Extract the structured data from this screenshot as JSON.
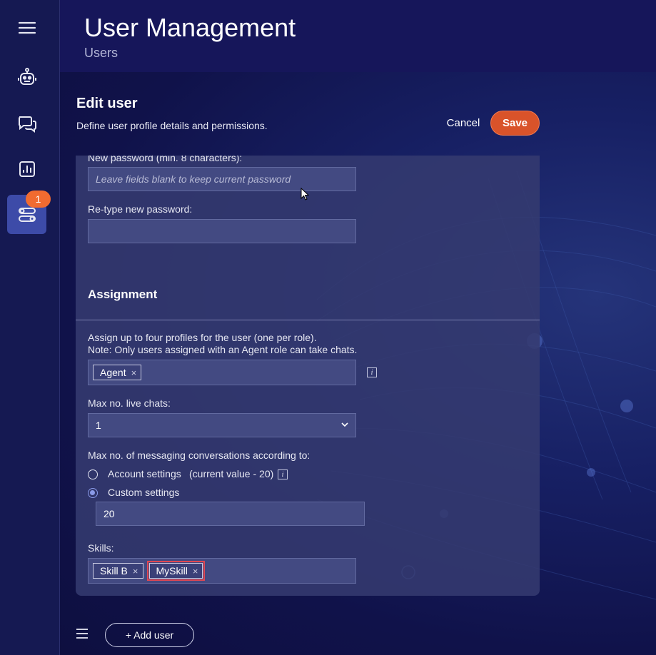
{
  "header": {
    "title": "User Management",
    "subtitle": "Users"
  },
  "sidebar": {
    "items": [
      {
        "icon": "menu-icon"
      },
      {
        "icon": "robot-icon"
      },
      {
        "icon": "chat-bubbles-icon"
      },
      {
        "icon": "chart-icon"
      },
      {
        "icon": "toggles-icon",
        "active": true,
        "badge": "1"
      }
    ]
  },
  "edit": {
    "title": "Edit user",
    "description": "Define user profile details and permissions.",
    "cancel_label": "Cancel",
    "save_label": "Save"
  },
  "form": {
    "new_password_label": "New password (min. 8 characters):",
    "new_password_placeholder": "Leave fields blank to keep current password",
    "retype_label": "Re-type new password:",
    "retype_value": "",
    "assignment_title": "Assignment",
    "profiles_label_line1": "Assign up to four profiles for the user (one per role).",
    "profiles_label_line2": "Note: Only users assigned with an Agent role can take chats.",
    "profiles": [
      "Agent"
    ],
    "max_live_chats_label": "Max no. live chats:",
    "max_live_chats_value": "1",
    "max_messaging_label": "Max no. of messaging conversations according to:",
    "account_settings_label": "Account settings",
    "account_settings_note": "(current value - 20)",
    "custom_settings_label": "Custom settings",
    "custom_value": "20",
    "skills_label": "Skills:",
    "skills": [
      "Skill B",
      "MySkill"
    ],
    "chip_remove": "×",
    "info_glyph": "i"
  },
  "footer": {
    "add_user_label": "+ Add user"
  },
  "colors": {
    "accent": "#d9532a",
    "badge": "#f26b30",
    "highlight": "#e04752"
  }
}
